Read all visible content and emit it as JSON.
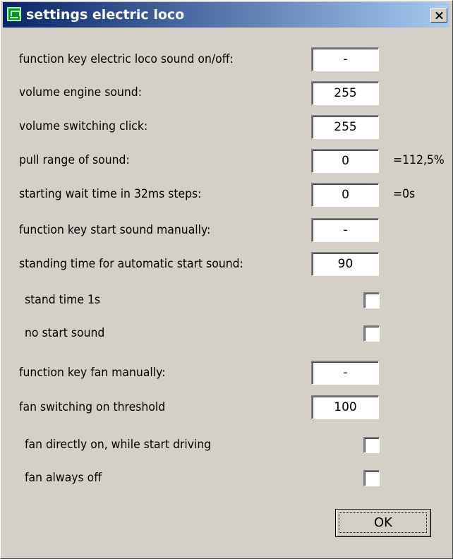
{
  "window": {
    "title": "settings electric loco",
    "close_symbol": "close-icon"
  },
  "settings": {
    "fn_key_sound": {
      "label": "function key electric loco sound on/off:",
      "value": "-"
    },
    "volume_engine": {
      "label": "volume engine sound:",
      "value": "255"
    },
    "volume_click": {
      "label": "volume switching click:",
      "value": "255"
    },
    "pull_range": {
      "label": "pull range of sound:",
      "value": "0",
      "suffix": "=112,5%"
    },
    "start_wait": {
      "label": "starting wait time in 32ms steps:",
      "value": "0",
      "suffix": "=0s"
    },
    "fn_key_start": {
      "label": "function key start sound manually:",
      "value": "-"
    },
    "standing_time": {
      "label": "standing time for automatic start sound:",
      "value": "90"
    },
    "stand_time_1s": {
      "label": "stand time 1s",
      "checked": false
    },
    "no_start_sound": {
      "label": "no start sound",
      "checked": false
    },
    "fn_key_fan": {
      "label": "function key fan manually:",
      "value": "-"
    },
    "fan_threshold": {
      "label": "fan switching on threshold",
      "value": "100"
    },
    "fan_direct_on": {
      "label": "fan directly on, while start driving",
      "checked": false
    },
    "fan_always_off": {
      "label": "fan always off",
      "checked": false
    }
  },
  "buttons": {
    "ok_label": "OK"
  }
}
